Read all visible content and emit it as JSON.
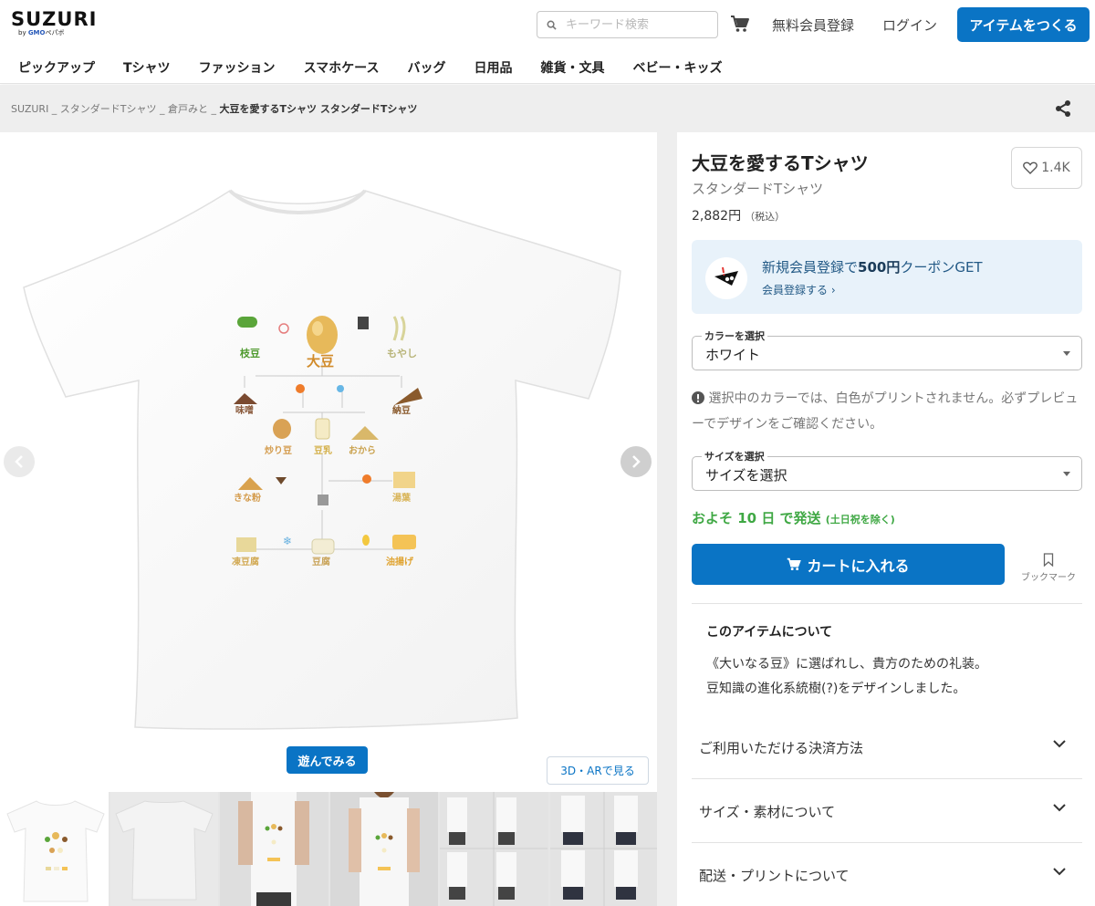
{
  "header": {
    "logo": "SUZURI",
    "logo_sub_prefix": "by ",
    "logo_sub_brand": "GMO",
    "logo_sub_suffix": "ペパボ",
    "search_placeholder": "キーワード検索",
    "signup_link": "無料会員登録",
    "login_link": "ログイン",
    "create_button": "アイテムをつくる",
    "categories": [
      "ピックアップ",
      "Tシャツ",
      "ファッション",
      "スマホケース",
      "バッグ",
      "日用品",
      "雑貨・文具",
      "ベビー・キッズ"
    ]
  },
  "breadcrumb": {
    "path": "SUZURI _ スタンダードTシャツ _ 倉戸みと _ ",
    "current": "大豆を愛するTシャツ スタンダードTシャツ"
  },
  "gallery": {
    "play_button": "遊んでみる",
    "ar_button": "3D・ARで見る",
    "design_labels": [
      "枝豆",
      "大豆",
      "もやし",
      "味噌",
      "納豆",
      "炒り豆",
      "豆乳",
      "おから",
      "きな粉",
      "湯葉",
      "凍豆腐",
      "豆腐",
      "油揚げ"
    ]
  },
  "product": {
    "title": "大豆を愛するTシャツ",
    "subtitle": "スタンダードTシャツ",
    "price": "2,882円",
    "tax_note": "（税込）",
    "likes": "1.4K",
    "coupon_prefix": "新規会員登録で",
    "coupon_amount": "500円",
    "coupon_suffix": "クーポンGET",
    "coupon_link": "会員登録する ›",
    "color_legend": "カラーを選択",
    "color_value": "ホワイト",
    "color_warning": "選択中のカラーでは、白色がプリントされません。必ずプレビューでデザインをご確認ください。",
    "size_legend": "サイズを選択",
    "size_value": "サイズを選択",
    "shipping": "およそ 10 日 で発送",
    "shipping_note": "(土日祝を除く)",
    "cart_button": "カートに入れる",
    "bookmark_label": "ブックマーク",
    "about_heading": "このアイテムについて",
    "about_line1": "《大いなる豆》に選ばれし、貴方のための礼装。",
    "about_line2": "豆知識の進化系統樹(?)をデザインしました。",
    "accordions": [
      "ご利用いただける決済方法",
      "サイズ・素材について",
      "配送・プリントについて"
    ]
  },
  "colors": {
    "accent_blue": "#0a74c5",
    "ship_green": "#3fa844",
    "coupon_bg": "#e8f2fa"
  }
}
